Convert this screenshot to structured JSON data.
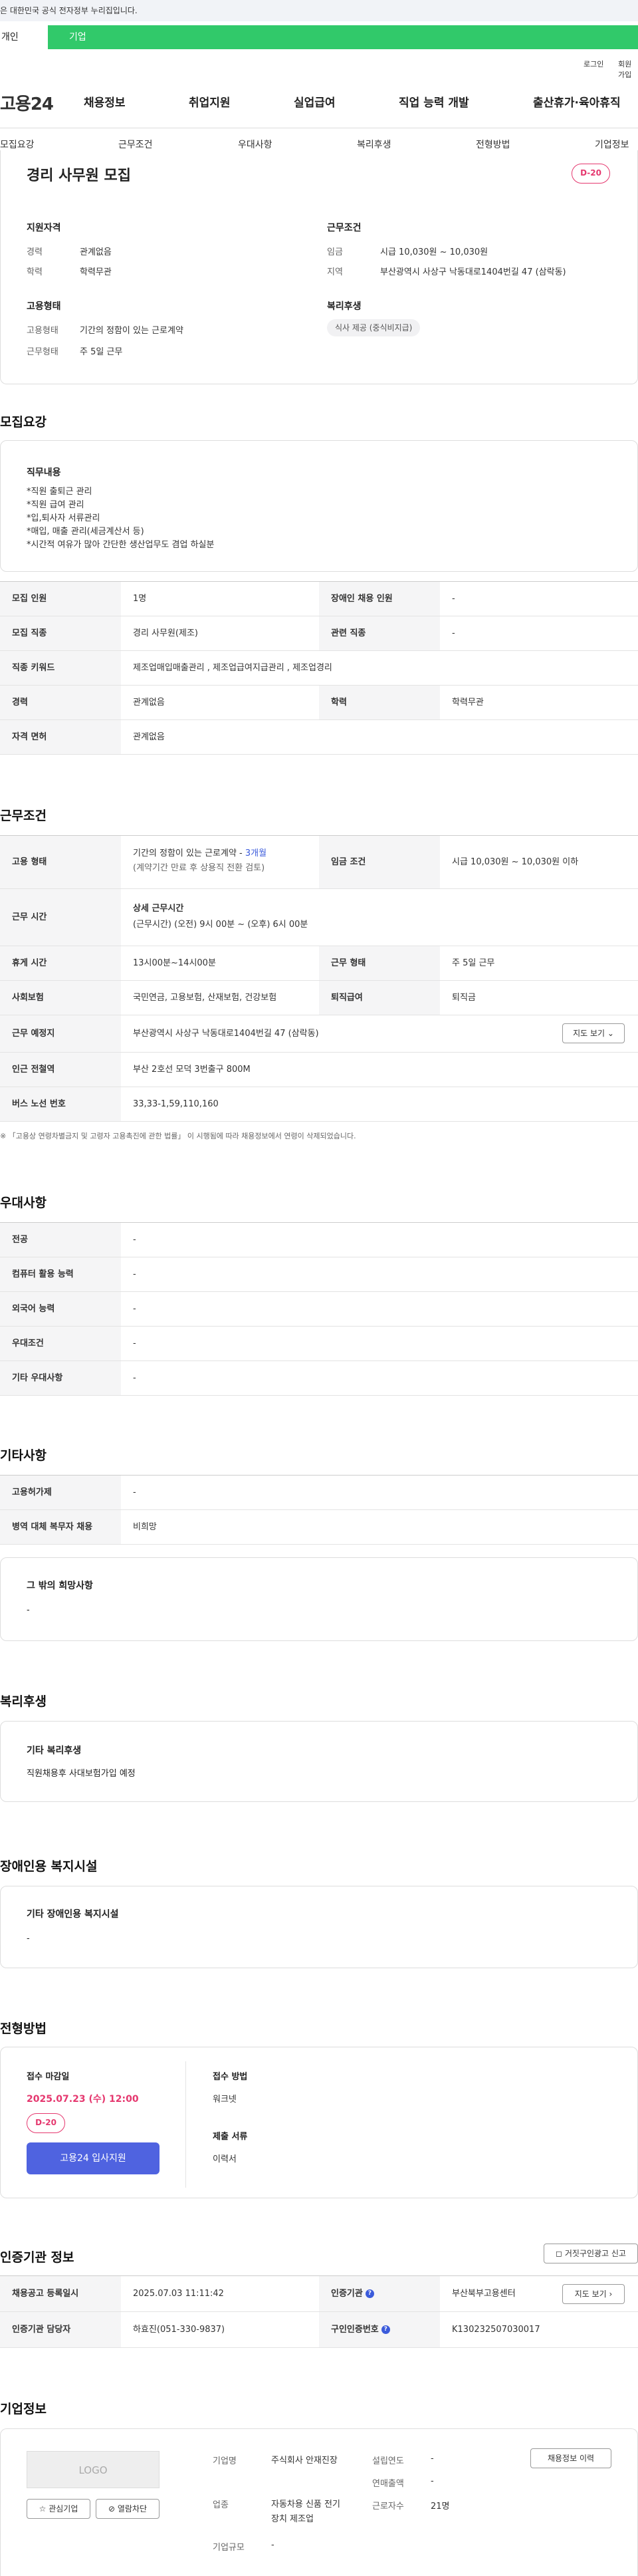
{
  "gov_banner": "이 누리집은 대한민국 공식 전자정부 누리집입니다.",
  "topnav": {
    "tab1": "개인",
    "tab2": "기업"
  },
  "util": {
    "login": "로그인",
    "join": "회원가입"
  },
  "header": {
    "logo": "고용24",
    "gnb": [
      "채용정보",
      "취업지원",
      "실업급여",
      "직업 능력 개발",
      "출산휴가·육아휴직"
    ]
  },
  "tabs": [
    "모집요강",
    "근무조건",
    "우대사항",
    "복리후생",
    "전형방법",
    "기업정보"
  ],
  "summary": {
    "title": "경리 사무원 모집",
    "dday": "D-20",
    "qual_title": "지원자격",
    "career_label": "경력",
    "career": "관계없음",
    "edu_label": "학력",
    "edu": "학력무관",
    "cond_title": "근무조건",
    "wage_label": "임금",
    "wage": "시급 10,030원 ~ 10,030원",
    "region_label": "지역",
    "region": "부산광역시 사상구 낙동대로1404번길 47 (삼락동)",
    "emp_title": "고용형태",
    "emptype_label": "고용형태",
    "emptype": "기간의 정함이 있는 근로계약",
    "worktype_label": "근무형태",
    "worktype": "주 5일 근무",
    "welfare_title": "복리후생",
    "welfare_tag": "식사 제공 (중식비지급)"
  },
  "recruit": {
    "title": "모집요강",
    "duty_title": "직무내용",
    "duty_lines": [
      "*직원 출퇴근 관리",
      "*직원 급여 관리",
      "*입,퇴사자 서류관리",
      "*매입, 매출 관리(세금계산서 등)",
      "*시간적 여유가 많아 간단한 생산업무도 겸업 하실분"
    ],
    "rows": [
      {
        "th1": "모집 인원",
        "td1": "1명",
        "th2": "장애인 채용 인원",
        "td2": "-"
      },
      {
        "th1": "모집 직종",
        "td1": "경리 사무원(제조)",
        "th2": "관련 직종",
        "td2": "-"
      },
      {
        "th1": "직종 키워드",
        "td1": "제조업매입매출관리 , 제조업급여지급관리 , 제조업경리"
      },
      {
        "th1": "경력",
        "td1": "관계없음",
        "th2": "학력",
        "td2": "학력무관"
      },
      {
        "th1": "자격 면허",
        "td1": "관계없음"
      }
    ]
  },
  "work": {
    "title": "근무조건",
    "emp_th": "고용 형태",
    "emp_td1": "기간의 정함이 있는 근로계약 - ",
    "emp_td_blue": "3개월",
    "emp_td2": "(계약기간 만료 후 상용직 전환 검토)",
    "wage_th": "임금 조건",
    "wage_td": "시급 10,030원 ~ 10,030원 이하",
    "time_th": "근무 시간",
    "time_sub": "상세 근무시간",
    "time_td": "(근무시간) (오전) 9시 00분 ~ (오후) 6시 00분",
    "rest_th": "휴게 시간",
    "rest_td": "13시00분~14시00분",
    "form_th": "근무 형태",
    "form_td": "주 5일 근무",
    "ins_th": "사회보험",
    "ins_td": "국민연금, 고용보험, 산재보험, 건강보험",
    "retire_th": "퇴직급여",
    "retire_td": "퇴직금",
    "place_th": "근무 예정지",
    "place_td": "부산광역시 사상구 낙동대로1404번길 47 (삼락동)",
    "map_btn": "지도 보기",
    "subway_th": "인근 전철역",
    "subway_td": "부산 2호선 모덕 3번출구 800M",
    "bus_th": "버스 노선 번호",
    "bus_td": "33,33-1,59,110,160",
    "note": "「고용상 연령차별금지 및 고령자 고용촉진에 관한 법률」 이 시행됨에 따라 채용정보에서 연령이 삭제되었습니다."
  },
  "pref": {
    "title": "우대사항",
    "rows": [
      {
        "th": "전공",
        "td": "-"
      },
      {
        "th": "컴퓨터 활용 능력",
        "td": "-"
      },
      {
        "th": "외국어 능력",
        "td": "-"
      },
      {
        "th": "우대조건",
        "td": "-"
      },
      {
        "th": "기타 우대사항",
        "td": "-"
      }
    ]
  },
  "etc": {
    "title": "기타사항",
    "rows": [
      {
        "th": "고용허가제",
        "td": "-"
      },
      {
        "th": "병역 대체 복무자 채용",
        "td": "비희망"
      }
    ],
    "hope_title": "그 밖의 희망사항",
    "hope_val": "-"
  },
  "welfare": {
    "title": "복리후생",
    "box_title": "기타 복리후생",
    "box_val": "직원채용후 사대보험가입 예정"
  },
  "disab": {
    "title": "장애인용 복지시설",
    "box_title": "기타 장애인용 복지시설",
    "box_val": "-"
  },
  "screen": {
    "title": "전형방법",
    "deadline_label": "접수 마감일",
    "deadline": "2025.07.23 (수) 12:00",
    "dday": "D-20",
    "apply_btn": "고용24 입사지원",
    "method_label": "접수 방법",
    "method": "워크넷",
    "docs_label": "제출 서류",
    "docs": "이력서"
  },
  "cert": {
    "title": "인증기관 정보",
    "report_btn": "거짓구인광고 신고",
    "r1_th1": "채용공고 등록일시",
    "r1_td1": "2025.07.03 11:11:42",
    "r1_th2": "인증기관",
    "r1_td2": "부산북부고용센터",
    "map_btn": "지도 보기",
    "r2_th1": "인증기관 담당자",
    "r2_td1": "하효진(051-330-9837)",
    "r2_th2": "구인인증번호",
    "r2_td2": "K130232507030017"
  },
  "company": {
    "title": "기업정보",
    "logo": "LOGO",
    "fav_btn": "관심기업",
    "block_btn": "열람차단",
    "name_label": "기업명",
    "name": "주식회사 안재진장",
    "biz_label": "업종",
    "biz": "자동차용 신품 전기장치 제조업",
    "size_label": "기업규모",
    "size": "-",
    "est_label": "설립연도",
    "est": "-",
    "sales_label": "연매출액",
    "sales": "-",
    "emp_label": "근로자수",
    "emp": "21명",
    "history_btn": "채용정보 이력"
  }
}
